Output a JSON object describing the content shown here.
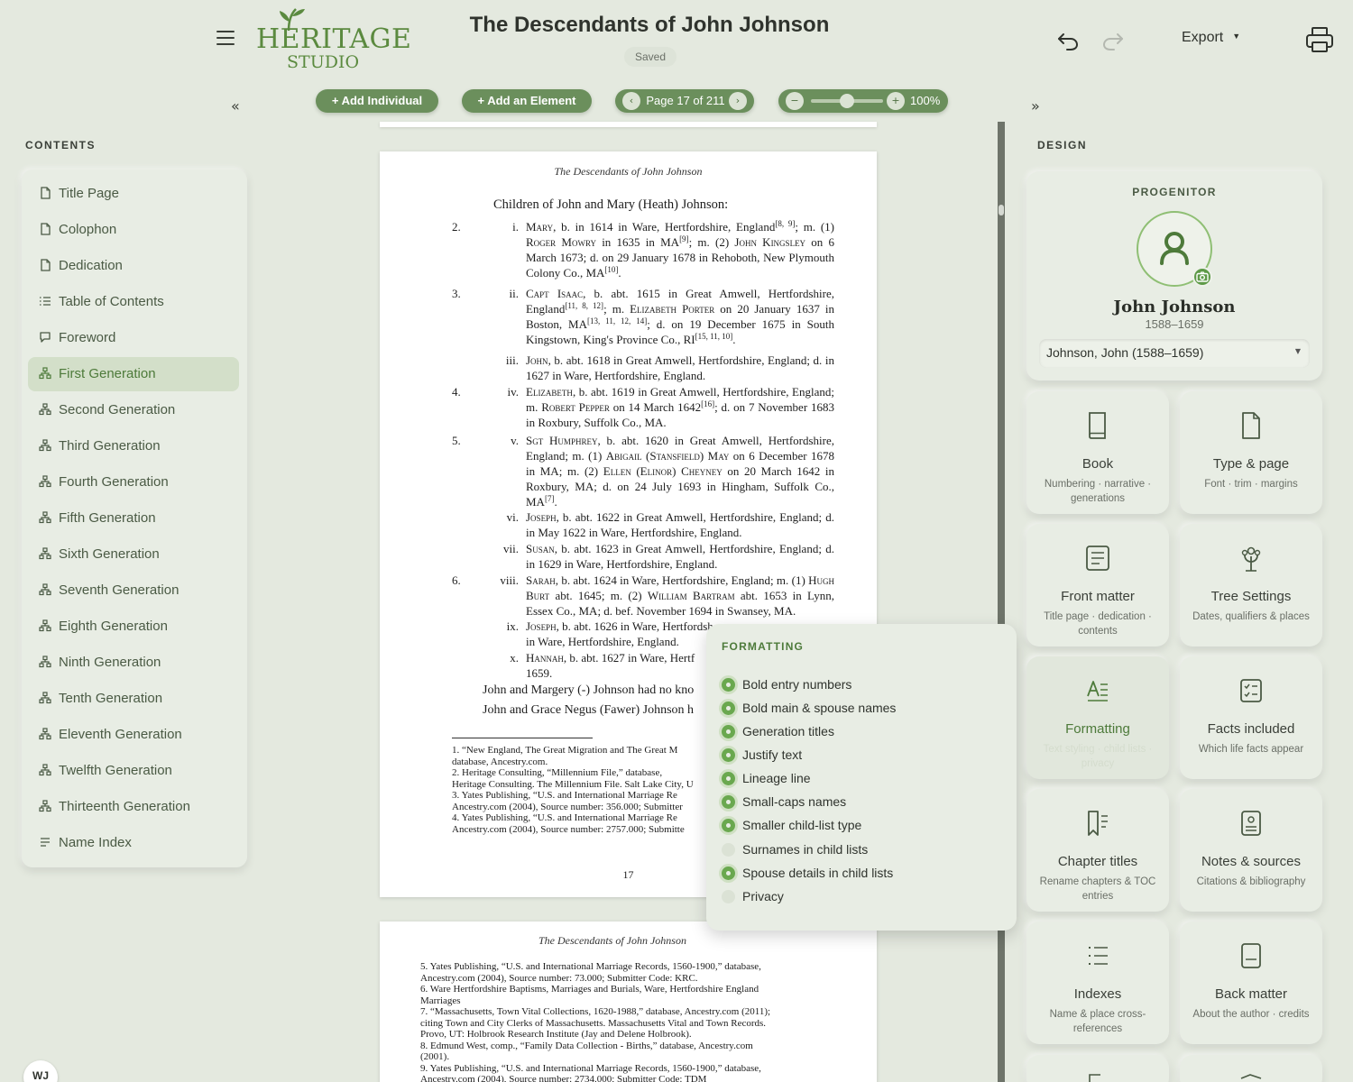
{
  "app": {
    "logo_main": "HERITAGE",
    "logo_sub": "STUDIO",
    "document_title": "The Descendants of John Johnson",
    "save_status": "Saved",
    "export_label": "Export",
    "user_initials": "WJ"
  },
  "toolbar": {
    "add_individual": "+ Add Individual",
    "add_element": "+ Add an Element",
    "page_indicator": "Page 17 of 211",
    "zoom_level": "100%",
    "zoom_fraction": 0.5,
    "prev_glyph": "‹",
    "next_glyph": "›",
    "zoom_out_glyph": "−",
    "zoom_in_glyph": "+",
    "collapse_left_glyph": "«",
    "collapse_right_glyph": "»"
  },
  "contents": {
    "heading": "CONTENTS",
    "items": [
      {
        "label": "Title Page",
        "icon": "page-icon"
      },
      {
        "label": "Colophon",
        "icon": "page-icon"
      },
      {
        "label": "Dedication",
        "icon": "page-icon"
      },
      {
        "label": "Table of Contents",
        "icon": "list-icon"
      },
      {
        "label": "Foreword",
        "icon": "speech-bubble-icon"
      },
      {
        "label": "First Generation",
        "icon": "tree-icon",
        "active": true
      },
      {
        "label": "Second Generation",
        "icon": "tree-icon"
      },
      {
        "label": "Third Generation",
        "icon": "tree-icon"
      },
      {
        "label": "Fourth Generation",
        "icon": "tree-icon"
      },
      {
        "label": "Fifth Generation",
        "icon": "tree-icon"
      },
      {
        "label": "Sixth Generation",
        "icon": "tree-icon"
      },
      {
        "label": "Seventh Generation",
        "icon": "tree-icon"
      },
      {
        "label": "Eighth Generation",
        "icon": "tree-icon"
      },
      {
        "label": "Ninth Generation",
        "icon": "tree-icon"
      },
      {
        "label": "Tenth Generation",
        "icon": "tree-icon"
      },
      {
        "label": "Eleventh Generation",
        "icon": "tree-icon"
      },
      {
        "label": "Twelfth Generation",
        "icon": "tree-icon"
      },
      {
        "label": "Thirteenth Generation",
        "icon": "tree-icon"
      },
      {
        "label": "Name Index",
        "icon": "index-lines-icon"
      }
    ]
  },
  "document": {
    "running_head": "The Descendants of John Johnson",
    "children_heading": "Children of John and Mary (Heath) Johnson:",
    "para1": "John and Margery (-) Johnson had no kno",
    "para2": "John and Grace Negus (Fawer) Johnson h",
    "page_number": "17",
    "footnotes": [
      "1. “New England, The Great Migration and The Great M",
      "database, Ancestry.com.",
      "2. Heritage Consulting, “Millennium File,” database,",
      "Heritage Consulting. The Millennium File. Salt Lake City, U",
      "3. Yates Publishing, “U.S. and International Marriage Re",
      "Ancestry.com (2004), Source number: 356.000; Submitter",
      "4. Yates Publishing, “U.S. and International Marriage Re",
      "Ancestry.com (2004), Source number: 2757.000; Submitte"
    ],
    "page2_footnotes": [
      "5. Yates Publishing, “U.S. and International Marriage Records, 1560-1900,” database,",
      "Ancestry.com (2004), Source number: 73.000; Submitter Code: KRC.",
      "6. Ware Hertfordshire Baptisms, Marriages and Burials, Ware, Hertfordshire England",
      "Marriages",
      "7. “Massachusetts, Town Vital Collections, 1620-1988,” database, Ancestry.com (2011);",
      "citing Town and City Clerks of Massachusetts. Massachusetts Vital and Town Records.",
      "Provo, UT: Holbrook Research Institute (Jay and Delene Holbrook).",
      "8. Edmund West, comp., “Family Data Collection - Births,” database, Ancestry.com",
      "(2001).",
      "9. Yates Publishing, “U.S. and International Marriage Records, 1560-1900,” database,",
      "Ancestry.com (2004), Source number: 2734.000; Submitter Code: TDM"
    ]
  },
  "formatting": {
    "heading": "FORMATTING",
    "options": [
      {
        "label": "Bold entry numbers",
        "on": true
      },
      {
        "label": "Bold main & spouse names",
        "on": true
      },
      {
        "label": "Generation titles",
        "on": true
      },
      {
        "label": "Justify text",
        "on": true
      },
      {
        "label": "Lineage line",
        "on": true
      },
      {
        "label": "Small-caps names",
        "on": true
      },
      {
        "label": "Smaller child-list type",
        "on": true
      },
      {
        "label": "Surnames in child lists",
        "on": false
      },
      {
        "label": "Spouse details in child lists",
        "on": true
      },
      {
        "label": "Privacy",
        "on": false
      }
    ]
  },
  "design": {
    "heading": "DESIGN",
    "progenitor_label": "PROGENITOR",
    "progenitor_name": "John Johnson",
    "progenitor_dates": "1588–1659",
    "progenitor_select": "Johnson, John (1588–1659)",
    "tiles": [
      {
        "title": "Book",
        "sub": "Numbering · narrative · generations",
        "icon": "book-icon"
      },
      {
        "title": "Type & page",
        "sub": "Font · trim · margins",
        "icon": "document-icon"
      },
      {
        "title": "Front matter",
        "sub": "Title page · dedication · contents",
        "icon": "text-page-icon"
      },
      {
        "title": "Tree Settings",
        "sub": "Dates, qualifiers & places",
        "icon": "branch-icon"
      },
      {
        "title": "Formatting",
        "sub": "Text styling · child lists · privacy",
        "icon": "text-format-icon",
        "active": true
      },
      {
        "title": "Facts included",
        "sub": "Which life facts appear",
        "icon": "checklist-icon"
      },
      {
        "title": "Chapter titles",
        "sub": "Rename chapters & TOC entries",
        "icon": "bookmark-icon"
      },
      {
        "title": "Notes & sources",
        "sub": "Citations & bibliography",
        "icon": "notes-icon"
      },
      {
        "title": "Indexes",
        "sub": "Name & place cross-references",
        "icon": "bullet-list-icon"
      },
      {
        "title": "Back matter",
        "sub": "About the author · credits",
        "icon": "back-page-icon"
      }
    ]
  },
  "colors": {
    "accent": "#6b8f5c",
    "accent_text": "#4d7a3a",
    "background": "#e4e9df",
    "toggle_on": "#6aa84f"
  }
}
